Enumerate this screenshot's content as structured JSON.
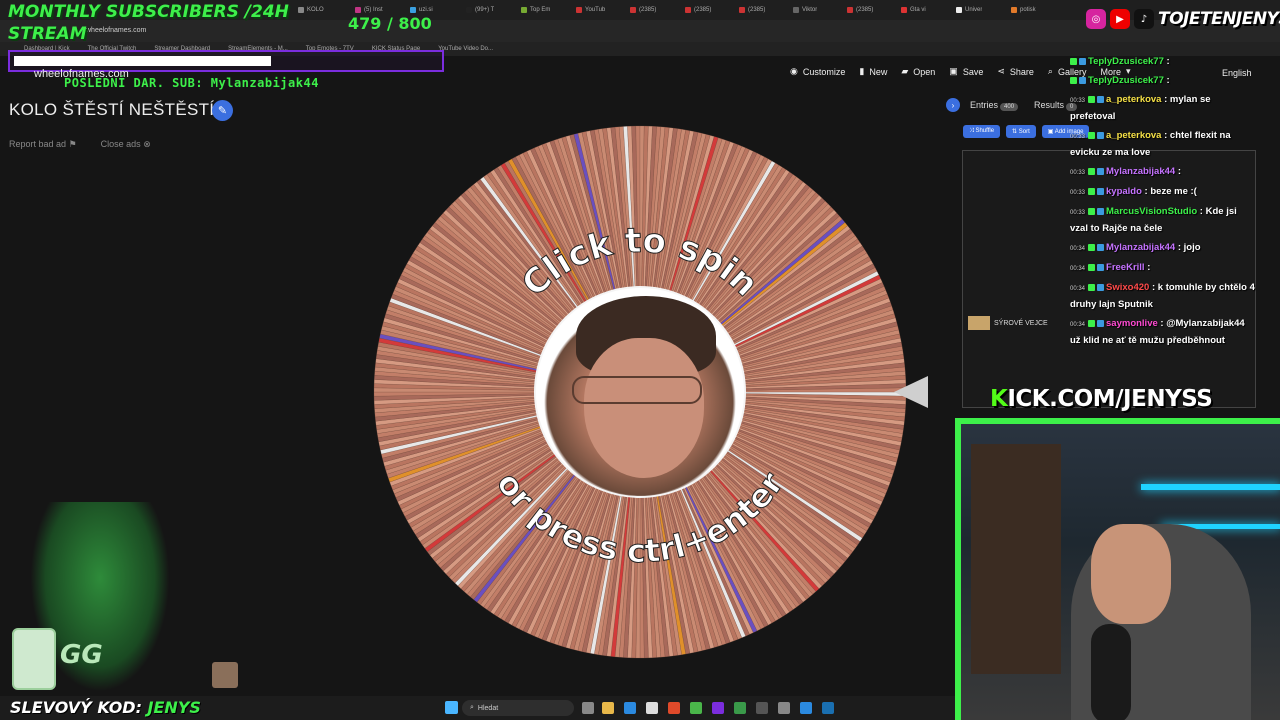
{
  "browser": {
    "tabs": [
      "KOLO",
      "(5) Inst",
      "uzi.si",
      "(99+) T",
      "Top Em",
      "YouTub",
      "(2385)",
      "(2385)",
      "(2385)",
      "Viktor",
      "(2385)",
      "Gta vi",
      "Univer",
      "potisk"
    ],
    "url": "wheelofnames.com",
    "bookmarks": [
      "Dashboard | Kick",
      "The Official Twitch",
      "Streamer Dashboard",
      "StreamElements - M...",
      "Top Emotes - 7TV",
      "KICK Status Page",
      "YouTube Video Do..."
    ]
  },
  "overlay": {
    "subs_title_line1": "MONTHLY SUBSCRIBERS /24H",
    "subs_title_line2": "STREAM",
    "subs_count": "479  / 800",
    "subs_progress": 0.6,
    "last_sub": "POSLEDNÍ DAR. SUB: Mylanzabijak44",
    "handle": "TOJETENJENYS",
    "kick_url_k": "K",
    "kick_url_rest": "ICK.COM/JENYSS",
    "promo_label": "SLEVOVÝ KOD: ",
    "promo_code": "JENYS",
    "sponsor_logo": "GG"
  },
  "site": {
    "url_display": "wheelofnames.com",
    "nav": {
      "customize": "Customize",
      "new": "New",
      "open": "Open",
      "save": "Save",
      "share": "Share",
      "gallery": "Gallery",
      "more": "More",
      "language": "English"
    },
    "title": "KOLO ŠTĚSTÍ NEŠTĚSTÍ",
    "report_ad": "Report bad ad",
    "close_ads": "Close ads",
    "wheel_text_top": "Click to spin",
    "wheel_text_bottom": "or press ctrl+enter",
    "entries_tab": "Entries",
    "entries_count": "400",
    "results_tab": "Results",
    "results_count": "0",
    "shuffle": "Shuffle",
    "sort": "Sort",
    "add_image": "Add image",
    "entry_sample": "SÝROVÉ VEJCE"
  },
  "chat": [
    {
      "time": "",
      "user": "TeplyDzusicek77",
      "color": "#3df04a",
      "text": ""
    },
    {
      "time": "",
      "user": "TeplyDzusicek77",
      "color": "#3df04a",
      "text": ""
    },
    {
      "time": "00:33",
      "user": "a_peterkova",
      "color": "#f5e046",
      "text": "mylan se prefetoval"
    },
    {
      "time": "00:33",
      "user": "a_peterkova",
      "color": "#f5e046",
      "text": "chtel flexit na evicku ze ma love"
    },
    {
      "time": "00:33",
      "user": "Mylanzabijak44",
      "color": "#c573ff",
      "text": ""
    },
    {
      "time": "00:33",
      "user": "kypaldo",
      "color": "#c573ff",
      "text": "beze me :("
    },
    {
      "time": "00:33",
      "user": "MarcusVisionStudio",
      "color": "#3df04a",
      "text": "Kde jsi vzal to Rajče na čele"
    },
    {
      "time": "00:34",
      "user": "Mylanzabijak44",
      "color": "#c573ff",
      "text": "jojo"
    },
    {
      "time": "00:34",
      "user": "FreeKrill",
      "color": "#c573ff",
      "text": ""
    },
    {
      "time": "00:34",
      "user": "Swixo420",
      "color": "#ff4a4a",
      "text": "k tomuhle by chtělo 4 druhy lajn Sputnik"
    },
    {
      "time": "00:34",
      "user": "saymonlive",
      "color": "#ff4ad2",
      "text": "@Mylanzabijak44 už klid ne ať tě mužu předběhnout"
    }
  ],
  "taskbar": {
    "search": "Hledat"
  },
  "colors": {
    "accent_green": "#3df04a",
    "accent_blue": "#3b6fe0",
    "kick_green": "#53fc18"
  }
}
